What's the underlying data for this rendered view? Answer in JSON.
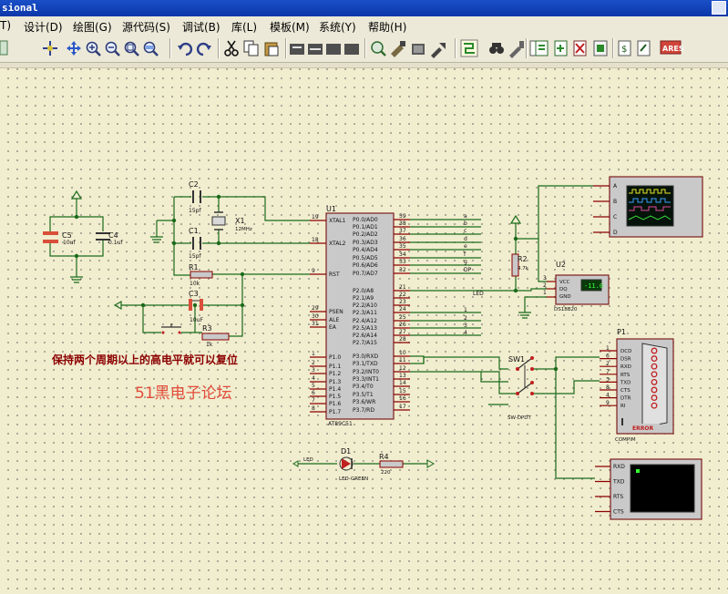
{
  "window": {
    "title": "sional"
  },
  "menu": {
    "view_fragment": "T)",
    "items": [
      "设计(D)",
      "绘图(G)",
      "源代码(S)",
      "调试(B)",
      "库(L)",
      "模板(M)",
      "系统(Y)",
      "帮助(H)"
    ]
  },
  "toolbar": {
    "buttons": [
      "refresh-icon",
      "crosshair-icon",
      "pan-icon",
      "zoom-in-icon",
      "zoom-out-icon",
      "zoom-all-icon",
      "zoom-area-icon",
      "undo-icon",
      "redo-icon",
      "cut-icon",
      "copy-icon",
      "paste-icon",
      "block-copy-icon",
      "block-move-icon",
      "block-rotate-icon",
      "block-delete-icon",
      "pick-device-icon",
      "make-device-icon",
      "package-tool-icon",
      "decompose-icon",
      "wire-autorouter-icon",
      "search-icon",
      "property-assign-icon",
      "new-sheet-icon",
      "add-sheet-icon",
      "remove-sheet-icon",
      "bom-icon",
      "erc-icon",
      "netlist-icon",
      "ares-icon"
    ],
    "ares_label": "ARES"
  },
  "schematic": {
    "u1": {
      "ref": "U1",
      "part": "AT89C51",
      "left_pins": [
        {
          "num": "19",
          "name": "XTAL1"
        },
        {
          "num": "18",
          "name": "XTAL2"
        },
        {
          "num": "9",
          "name": "RST"
        },
        {
          "num": "29",
          "name": "PSEN"
        },
        {
          "num": "30",
          "name": "ALE"
        },
        {
          "num": "31",
          "name": "EA"
        },
        {
          "num": "1",
          "name": "P1.0"
        },
        {
          "num": "2",
          "name": "P1.1"
        },
        {
          "num": "3",
          "name": "P1.2"
        },
        {
          "num": "4",
          "name": "P1.3"
        },
        {
          "num": "5",
          "name": "P1.4"
        },
        {
          "num": "6",
          "name": "P1.5"
        },
        {
          "num": "7",
          "name": "P1.6"
        },
        {
          "num": "8",
          "name": "P1.7"
        }
      ],
      "right_pins": [
        {
          "num": "39",
          "name": "P0.0/AD0"
        },
        {
          "num": "38",
          "name": "P0.1/AD1"
        },
        {
          "num": "37",
          "name": "P0.2/AD2"
        },
        {
          "num": "36",
          "name": "P0.3/AD3"
        },
        {
          "num": "35",
          "name": "P0.4/AD4"
        },
        {
          "num": "34",
          "name": "P0.5/AD5"
        },
        {
          "num": "33",
          "name": "P0.6/AD6"
        },
        {
          "num": "32",
          "name": "P0.7/AD7"
        },
        {
          "num": "21",
          "name": "P2.0/A8"
        },
        {
          "num": "22",
          "name": "P2.1/A9"
        },
        {
          "num": "23",
          "name": "P2.2/A10"
        },
        {
          "num": "24",
          "name": "P2.3/A11"
        },
        {
          "num": "25",
          "name": "P2.4/A12"
        },
        {
          "num": "26",
          "name": "P2.5/A13"
        },
        {
          "num": "27",
          "name": "P2.6/A14"
        },
        {
          "num": "28",
          "name": "P2.7/A15"
        },
        {
          "num": "10",
          "name": "P3.0/RXD"
        },
        {
          "num": "11",
          "name": "P3.1/TXD"
        },
        {
          "num": "12",
          "name": "P3.2/INT0"
        },
        {
          "num": "13",
          "name": "P3.3/INT1"
        },
        {
          "num": "14",
          "name": "P3.4/T0"
        },
        {
          "num": "15",
          "name": "P3.5/T1"
        },
        {
          "num": "16",
          "name": "P3.6/WR"
        },
        {
          "num": "17",
          "name": "P3.7/RD"
        }
      ],
      "p0_net_labels": [
        "a",
        "b",
        "c",
        "d",
        "e",
        "f",
        "g",
        "DP"
      ],
      "p2_net_labels": [
        "LED",
        "1",
        "2",
        "3",
        "4"
      ]
    },
    "components": {
      "c2": {
        "ref": "C2",
        "value": "15pf"
      },
      "c1": {
        "ref": "C1",
        "value": "15pf"
      },
      "x1": {
        "ref": "X1",
        "value": "12MHz"
      },
      "r1": {
        "ref": "R1",
        "value": "10k"
      },
      "c3": {
        "ref": "C3",
        "value": "10uF"
      },
      "r3": {
        "ref": "R3",
        "value": "1k"
      },
      "c5": {
        "ref": "C5",
        "value": "10uf"
      },
      "c4": {
        "ref": "C4",
        "value": "0.1uf"
      },
      "r2": {
        "ref": "R2",
        "value": "4.7k"
      },
      "u2": {
        "ref": "U2",
        "part": "DS18B20",
        "pins": [
          "VCC",
          "DQ",
          "GND"
        ],
        "pin_nums": [
          "3",
          "2",
          "1"
        ],
        "display": "-11.0"
      },
      "sw1": {
        "ref": "SW1",
        "part": "SW-DPDT"
      },
      "d1": {
        "ref": "D1",
        "part": "LED-GREEN",
        "net": "LED"
      },
      "r4": {
        "ref": "R4",
        "value": "220"
      },
      "p1": {
        "ref": "P1",
        "part": "COMPIM",
        "pins": [
          "DCD",
          "DSR",
          "RXD",
          "RTS",
          "TXD",
          "CTS",
          "DTR",
          "RI"
        ],
        "pin_nums": [
          "1",
          "6",
          "2",
          "7",
          "3",
          "8",
          "4",
          "9"
        ],
        "label": "ERROR"
      },
      "scope": {
        "channels": [
          "A",
          "B",
          "C",
          "D"
        ]
      },
      "terminal": {
        "pins": [
          "RXD",
          "TXD",
          "RTS",
          "CTS"
        ]
      }
    },
    "annotations": {
      "reset_note": "保持两个周期以上的高电平就可以复位",
      "watermark": "51黑电子论坛"
    },
    "colors": {
      "wire": "#1a6b1a",
      "body": "#c9c9c9",
      "body_border": "#7f1d1d",
      "pin": "#8b0000",
      "text": "#0b0b6b",
      "note": "#8b0000",
      "watermark": "#e24b3a"
    }
  }
}
